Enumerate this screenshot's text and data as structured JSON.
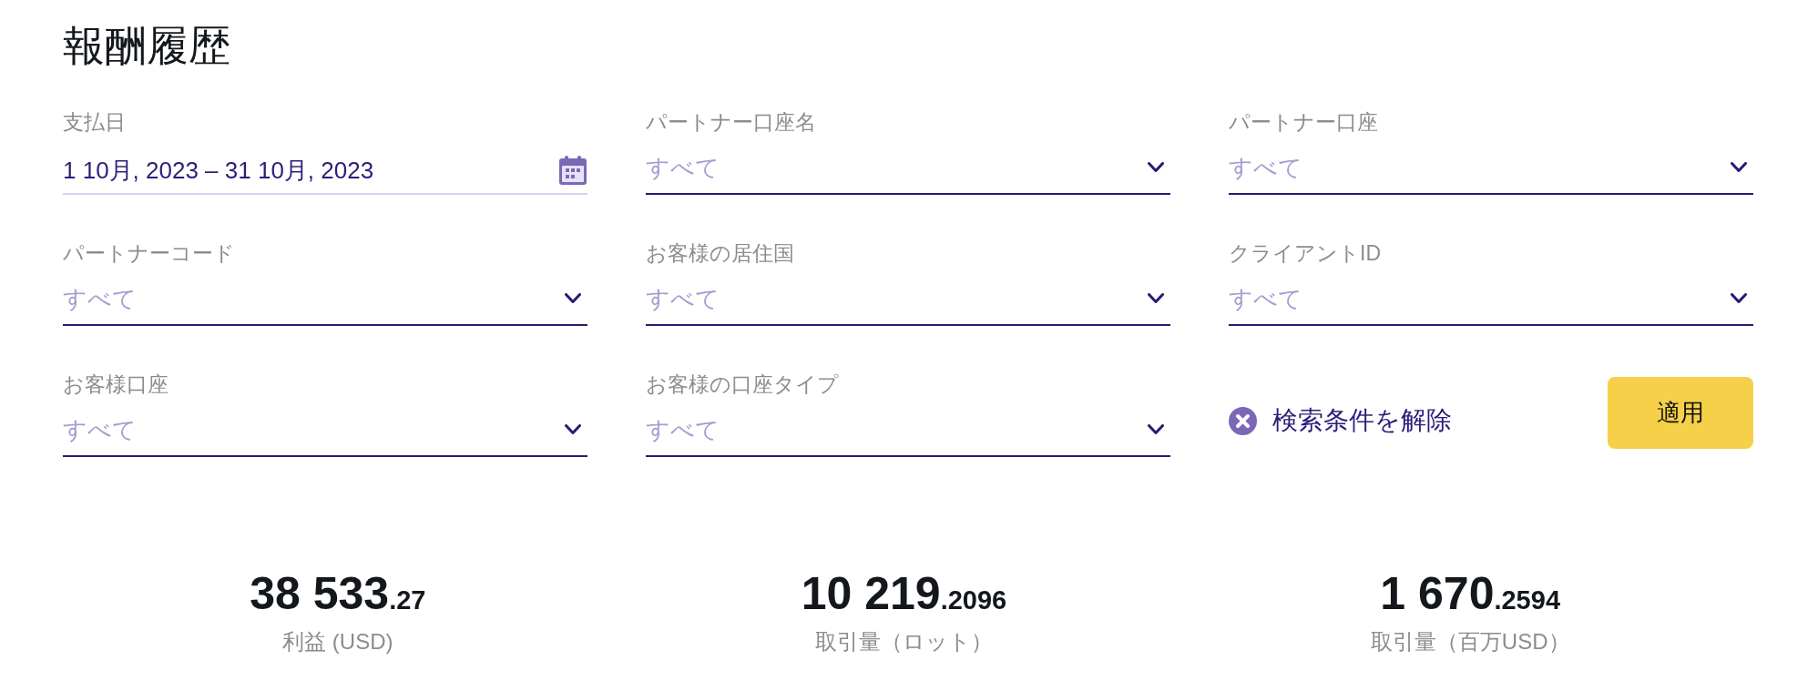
{
  "title": "報酬履歴",
  "filters": [
    {
      "kind": "date",
      "label": "支払日",
      "value": "1 10月, 2023 – 31 10月, 2023"
    },
    {
      "kind": "select",
      "label": "パートナー口座名",
      "placeholder": "すべて"
    },
    {
      "kind": "select",
      "label": "パートナー口座",
      "placeholder": "すべて"
    },
    {
      "kind": "select",
      "label": "パートナーコード",
      "placeholder": "すべて"
    },
    {
      "kind": "select",
      "label": "お客様の居住国",
      "placeholder": "すべて"
    },
    {
      "kind": "select",
      "label": "クライアントID",
      "placeholder": "すべて"
    },
    {
      "kind": "select",
      "label": "お客様口座",
      "placeholder": "すべて"
    },
    {
      "kind": "select",
      "label": "お客様の口座タイプ",
      "placeholder": "すべて"
    }
  ],
  "actions": {
    "clear_filters": "検索条件を解除",
    "apply": "適用"
  },
  "stats": [
    {
      "whole": "38 533",
      "decimals": ".27",
      "label": "利益 (USD)"
    },
    {
      "whole": "10 219",
      "decimals": ".2096",
      "label": "取引量（ロット）"
    },
    {
      "whole": "1 670",
      "decimals": ".2594",
      "label": "取引量（百万USD）"
    }
  ]
}
